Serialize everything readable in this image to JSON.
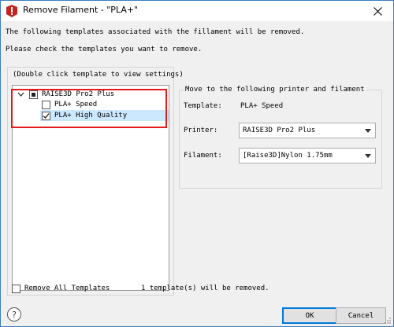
{
  "window": {
    "title": "Remove Filament - \"PLA+\"",
    "app_icon": "raise3d-app-icon",
    "accent": "#3c7dc4"
  },
  "messages": {
    "line1": "The following templates associated with the fillament will be removed.",
    "line2": "Please check the templates you want to remove."
  },
  "left_panel": {
    "hint": "(Double click template to view settings)",
    "highlight_color": "#e31b1b",
    "tree": {
      "printer": {
        "label": "RAISE3D Pro2 Plus",
        "state": "partial",
        "expanded": true
      },
      "templates": [
        {
          "label": "PLA+ Speed",
          "checked": false,
          "selected": false
        },
        {
          "label": "PLA+ High Quality",
          "checked": true,
          "selected": true
        }
      ]
    }
  },
  "right_panel": {
    "group_title": "Move to the following printer and filament",
    "template_label": "Template:",
    "template_value": "PLA+ Speed",
    "printer_label": "Printer:",
    "printer_value": "RAISE3D Pro2 Plus",
    "filament_label": "Filament:",
    "filament_value": "[Raise3D]Nylon 1.75mm"
  },
  "footer": {
    "remove_all_label": "Remove All Templates",
    "remove_all_checked": false,
    "status": "1 template(s) will be removed.",
    "ok_label": "OK",
    "cancel_label": "Cancel"
  }
}
